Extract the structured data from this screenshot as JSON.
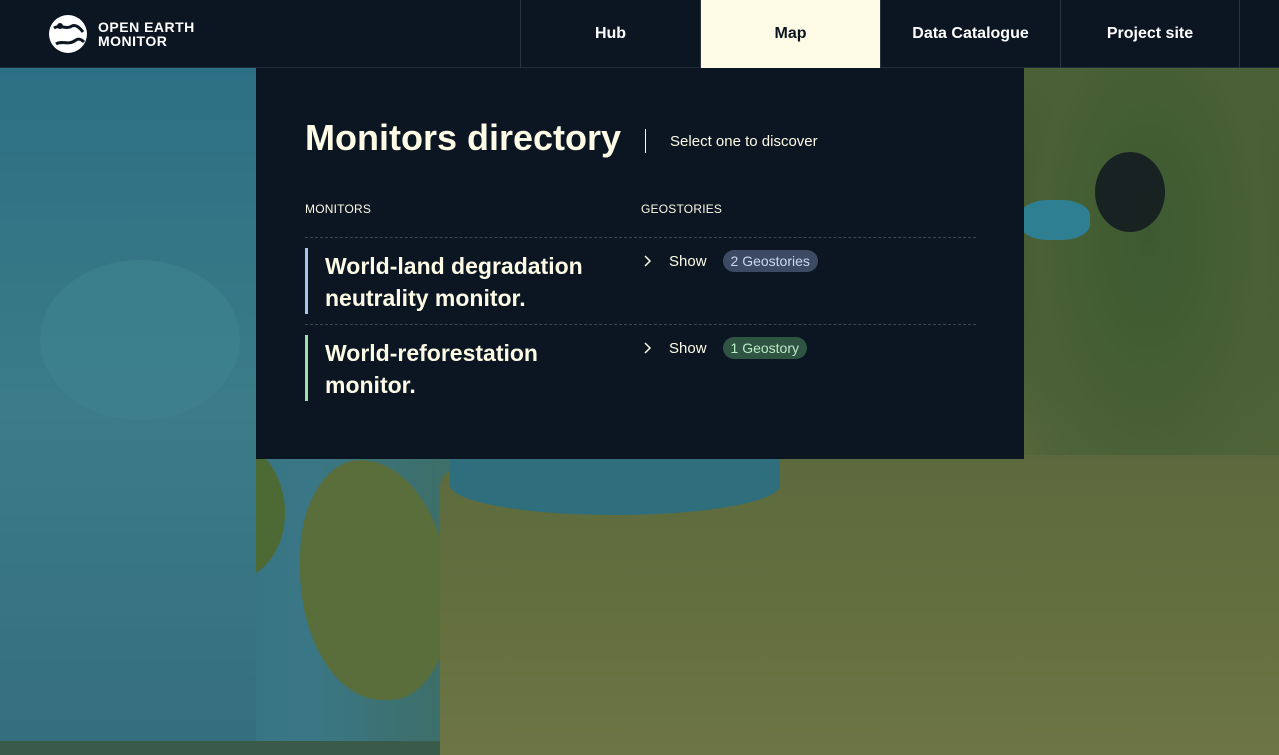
{
  "header": {
    "logo": {
      "line1": "OPEN EARTH",
      "line2": "MONITOR",
      "icon": "globe-logo-icon"
    },
    "nav": [
      {
        "label": "Hub",
        "active": false
      },
      {
        "label": "Map",
        "active": true
      },
      {
        "label": "Data Catalogue",
        "active": false
      },
      {
        "label": "Project site",
        "active": false
      }
    ]
  },
  "panel": {
    "title": "Monitors directory",
    "subtitle": "Select one to discover",
    "columns": {
      "monitors": "MONITORS",
      "geostories": "GEOSTORIES"
    },
    "rows": [
      {
        "name": "World-land degradation neutrality monitor.",
        "show_label": "Show",
        "badge": "2 Geostories",
        "accent_color": "#a8c4e8",
        "badge_bg": "#3c4b63",
        "badge_fg": "#c9d8ee"
      },
      {
        "name": "World-reforestation monitor.",
        "show_label": "Show",
        "badge": "1 Geostory",
        "accent_color": "#9be3a8",
        "badge_bg": "#2f5443",
        "badge_fg": "#b8ecc4"
      }
    ]
  },
  "colors": {
    "topbar_bg": "#0b1622",
    "active_tab_bg": "#fdfbe6",
    "panel_bg": "#0b1622",
    "text": "#fdfbe6"
  }
}
